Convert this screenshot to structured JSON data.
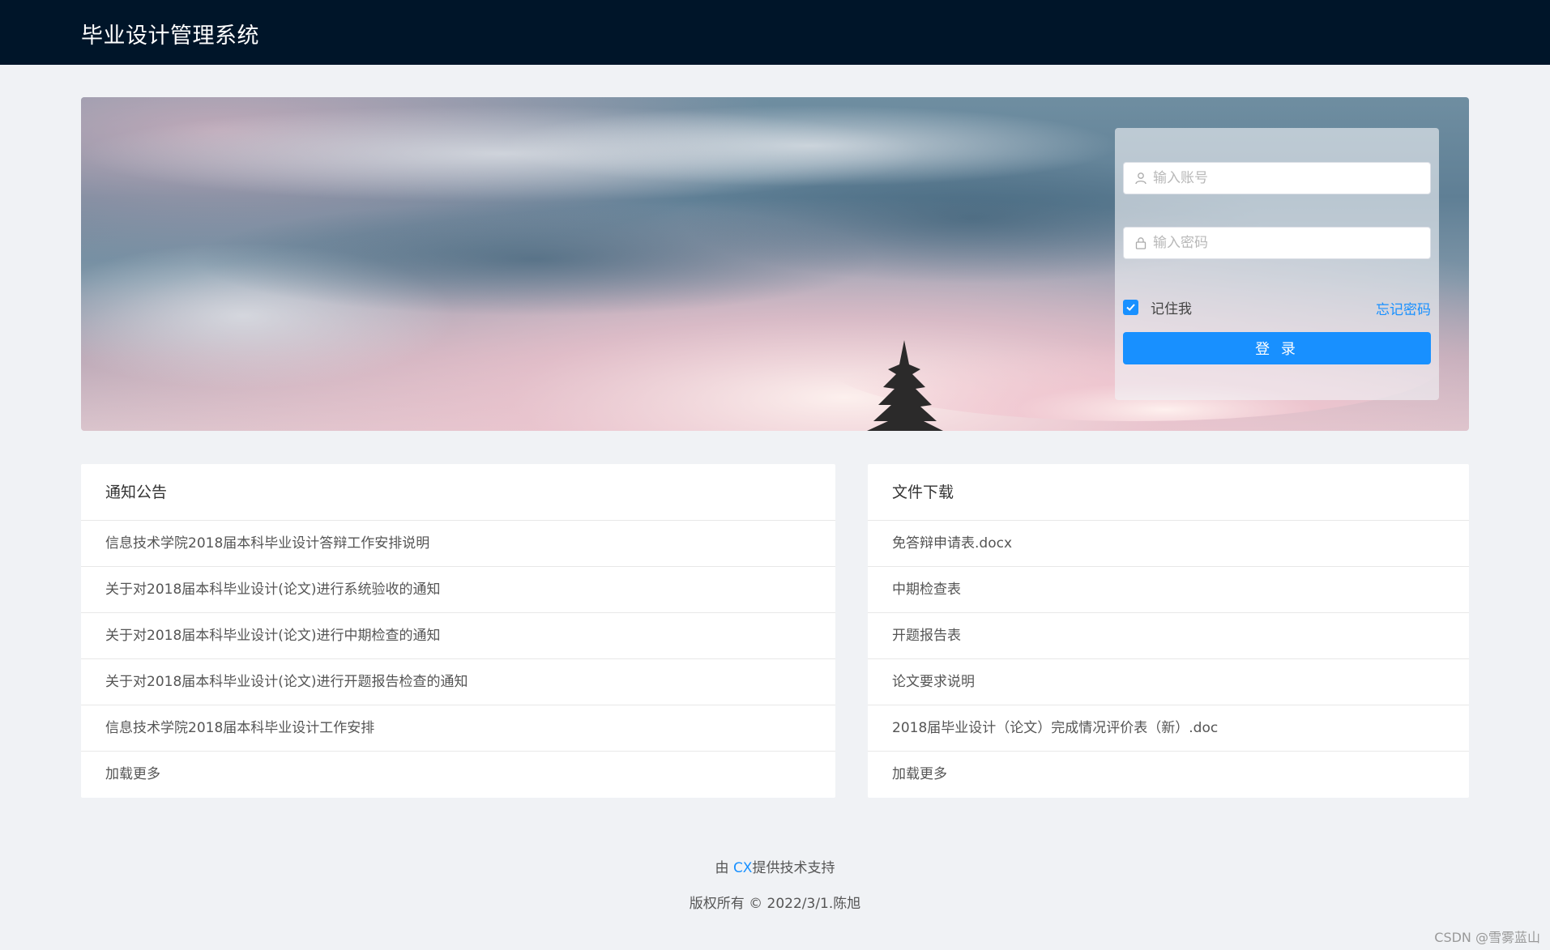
{
  "header": {
    "title": "毕业设计管理系统"
  },
  "login": {
    "account_placeholder": "输入账号",
    "password_placeholder": "输入密码",
    "remember_label": "记住我",
    "remember_checked": true,
    "forgot_label": "忘记密码",
    "submit_label": "登 录",
    "icons": {
      "account": "user-icon",
      "password": "lock-icon",
      "remember": "check-icon"
    }
  },
  "notice": {
    "title": "通知公告",
    "items": [
      "信息技术学院2018届本科毕业设计答辩工作安排说明",
      "关于对2018届本科毕业设计(论文)进行系统验收的通知",
      "关于对2018届本科毕业设计(论文)进行中期检查的通知",
      "关于对2018届本科毕业设计(论文)进行开题报告检查的通知",
      "信息技术学院2018届本科毕业设计工作安排"
    ],
    "more_label": "加载更多"
  },
  "files": {
    "title": "文件下载",
    "items": [
      "免答辩申请表.docx",
      "中期检查表",
      "开题报告表",
      "论文要求说明",
      "2018届毕业设计（论文）完成情况评价表（新）.doc"
    ],
    "more_label": "加载更多"
  },
  "footer": {
    "prefix": "由 ",
    "brand": "CX",
    "suffix": "提供技术支持",
    "copyright": "版权所有 © 2022/3/1.陈旭"
  },
  "watermark": "CSDN @雪雾蓝山",
  "colors": {
    "header_bg": "#001529",
    "primary": "#1890ff",
    "page_bg": "#f0f2f5"
  }
}
